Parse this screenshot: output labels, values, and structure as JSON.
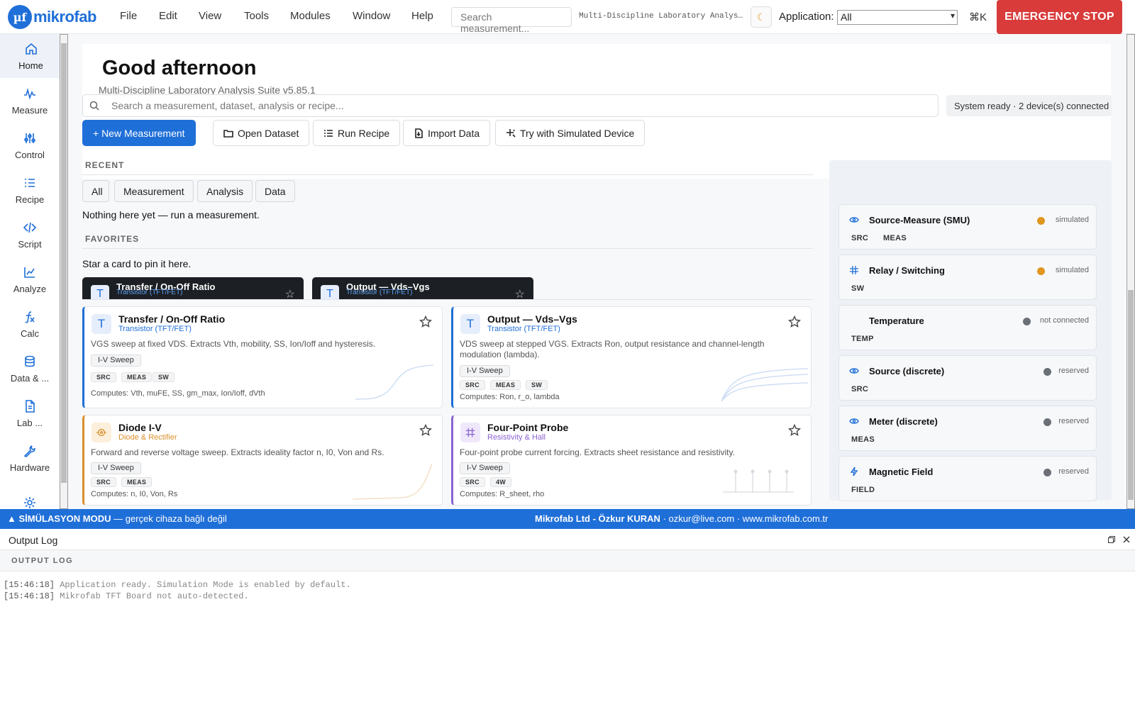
{
  "brand": {
    "badge": "µf",
    "name": "mikrofab"
  },
  "menu": [
    "File",
    "Edit",
    "View",
    "Tools",
    "Modules",
    "Window",
    "Help"
  ],
  "topbar": {
    "search_placeholder": "Search measurement...",
    "title": "Multi-Discipline Laboratory Analysis Suite",
    "theme_icon": "moon-icon",
    "application_label": "Application:",
    "application_value": "All",
    "shortcut": "⌘K",
    "emergency_stop": "EMERGENCY STOP"
  },
  "sidebar": {
    "items": [
      {
        "label": "Home",
        "icon": "home-icon"
      },
      {
        "label": "Measure",
        "icon": "wave-icon"
      },
      {
        "label": "Control",
        "icon": "sliders-icon"
      },
      {
        "label": "Recipe",
        "icon": "list-icon"
      },
      {
        "label": "Script",
        "icon": "code-icon"
      },
      {
        "label": "Analyze",
        "icon": "chart-icon"
      },
      {
        "label": "Calc",
        "icon": "function-icon"
      },
      {
        "label": "Data & ...",
        "icon": "database-icon"
      },
      {
        "label": "Lab ...",
        "icon": "document-icon"
      },
      {
        "label": "Hardware",
        "icon": "wrench-icon"
      }
    ]
  },
  "home": {
    "greeting": "Good afternoon",
    "subtitle": "Multi-Discipline Laboratory Analysis Suite  v5.85.1",
    "search_placeholder": "Search a measurement, dataset, analysis or recipe...",
    "system_status": "System ready · 2 device(s) connected",
    "actions": {
      "new_measurement": "+ New Measurement",
      "open_dataset": "Open Dataset",
      "run_recipe": "Run Recipe",
      "import_data": "Import Data",
      "try_simulated": "Try with Simulated Device"
    },
    "recent": {
      "title": "RECENT",
      "filters": [
        "All",
        "Measurement",
        "Analysis",
        "Data"
      ],
      "empty": "Nothing here yet — run a measurement."
    },
    "favorites": {
      "title": "FAVORITES",
      "empty": "Star a card to pin it here."
    }
  },
  "drag_cards": [
    {
      "title": "Transfer / On-Off Ratio",
      "category": "Transistor (TFT/FET)",
      "icon": "T"
    },
    {
      "title": "Output — Vds–Vgs",
      "category": "Transistor (TFT/FET)",
      "icon": "T"
    }
  ],
  "cards": [
    {
      "title": "Transfer / On-Off Ratio",
      "category": "Transistor (TFT/FET)",
      "icon": "T",
      "description": "VGS sweep at fixed VDS. Extracts Vth, mobility, SS, Ion/Ioff and hysteresis.",
      "tag": "I-V Sweep",
      "caps": [
        "SRC",
        "MEAS",
        "SW"
      ],
      "computes": "Computes: Vth, muFE, SS, gm_max, Ion/Ioff, dVth",
      "accent": "#1f6fd8"
    },
    {
      "title": "Output — Vds–Vgs",
      "category": "Transistor (TFT/FET)",
      "icon": "T",
      "description_1": "VDS sweep at stepped VGS. Extracts Ron, output resistance and channel-length",
      "description_2": "modulation (lambda).",
      "tag": "I-V Sweep",
      "caps": [
        "SRC",
        "MEAS",
        "SW"
      ],
      "computes": "Computes: Ron, r_o, lambda",
      "accent": "#1f6fd8"
    },
    {
      "title": "Diode I-V",
      "category": "Diode & Rectifier",
      "icon": "diode-icon",
      "description": "Forward and reverse voltage sweep. Extracts ideality factor n, I0, Von and Rs.",
      "tag": "I-V Sweep",
      "caps": [
        "SRC",
        "MEAS"
      ],
      "computes": "Computes: n, I0, Von, Rs",
      "accent": "#d9902b"
    },
    {
      "title": "Four-Point Probe",
      "category": "Resistivity & Hall",
      "icon": "grid-icon",
      "description": "Four-point probe current forcing. Extracts sheet resistance and resistivity.",
      "tag": "I-V Sweep",
      "caps": [
        "SRC",
        "4W"
      ],
      "computes": "Computes: R_sheet, rho",
      "accent": "#8a63d2"
    }
  ],
  "hardware": [
    {
      "name": "Source-Measure (SMU)",
      "status": "simulated",
      "status_color": "#e0961f",
      "caps": [
        "SRC",
        "MEAS"
      ],
      "icon": "eye-icon"
    },
    {
      "name": "Relay / Switching",
      "status": "simulated",
      "status_color": "#e0961f",
      "caps": [
        "SW"
      ],
      "icon": "grid-icon"
    },
    {
      "name": "Temperature",
      "status": "not connected",
      "status_color": "#6b6f76",
      "caps": [
        "TEMP"
      ],
      "icon": ""
    },
    {
      "name": "Source (discrete)",
      "status": "reserved",
      "status_color": "#6b6f76",
      "caps": [
        "SRC"
      ],
      "icon": "eye-icon"
    },
    {
      "name": "Meter (discrete)",
      "status": "reserved",
      "status_color": "#6b6f76",
      "caps": [
        "MEAS"
      ],
      "icon": "eye-icon"
    },
    {
      "name": "Magnetic Field",
      "status": "reserved",
      "status_color": "#6b6f76",
      "caps": [
        "FIELD"
      ],
      "icon": "bolt-icon"
    }
  ],
  "statusbar": {
    "mode": "▲ SİMÜLASYON MODU",
    "mode_note": " — gerçek cihaza bağlı değil",
    "company": "Mikrofab Ltd - Özkur KURAN",
    "email": " · ozkur@live.com · ",
    "website": "www.mikrofab.com.tr"
  },
  "output_log": {
    "window_title": "Output Log",
    "header": "OUTPUT LOG",
    "lines": [
      {
        "time": "[15:46:18]",
        "text": " Application ready. Simulation Mode is enabled by default."
      },
      {
        "time": "[15:46:18]",
        "text": " Mikrofab TFT Board not auto-detected."
      }
    ]
  },
  "colors": {
    "accent": "#1f6fd8",
    "estop": "#d93b3b",
    "statusbar": "#1f6fd8"
  }
}
